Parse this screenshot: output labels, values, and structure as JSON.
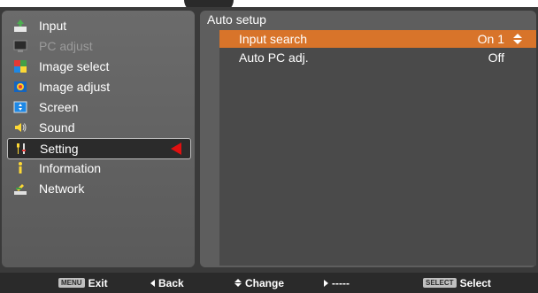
{
  "menu": {
    "items": [
      {
        "label": "Input",
        "icon": "input-icon",
        "state": "normal"
      },
      {
        "label": "PC adjust",
        "icon": "pc-adjust-icon",
        "state": "disabled"
      },
      {
        "label": "Image select",
        "icon": "image-select-icon",
        "state": "normal"
      },
      {
        "label": "Image adjust",
        "icon": "image-adjust-icon",
        "state": "normal"
      },
      {
        "label": "Screen",
        "icon": "screen-icon",
        "state": "normal"
      },
      {
        "label": "Sound",
        "icon": "sound-icon",
        "state": "normal"
      },
      {
        "label": "Setting",
        "icon": "setting-icon",
        "state": "selected"
      },
      {
        "label": "Information",
        "icon": "information-icon",
        "state": "normal"
      },
      {
        "label": "Network",
        "icon": "network-icon",
        "state": "normal"
      }
    ]
  },
  "submenu": {
    "title": "Auto setup",
    "rows": [
      {
        "label": "Input search",
        "value": "On 1",
        "selected": true
      },
      {
        "label": "Auto PC adj.",
        "value": "Off",
        "selected": false
      }
    ]
  },
  "footer": {
    "exit_key": "MENU",
    "exit_label": "Exit",
    "back_label": "Back",
    "change_label": "Change",
    "next_label": "-----",
    "select_key": "SELECT",
    "select_label": "Select"
  },
  "colors": {
    "selection_orange": "#d8742a",
    "pointer_red": "#e01010",
    "panel_gray": "#5e5e5e",
    "footer_dark": "#2a2a2a"
  }
}
